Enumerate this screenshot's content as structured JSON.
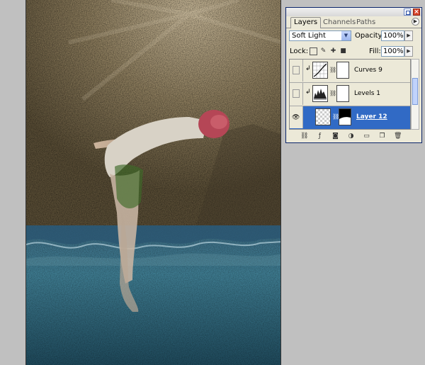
{
  "panel": {
    "tabs": [
      {
        "label": "Layers",
        "active": true
      },
      {
        "label": "Channels",
        "active": false
      },
      {
        "label": "Paths",
        "active": false
      }
    ],
    "blend_mode": "Soft Light",
    "opacity_label": "Opacity:",
    "opacity_value": "100%",
    "lock_label": "Lock:",
    "fill_label": "Fill:",
    "fill_value": "100%",
    "layers": [
      {
        "name": "Curves 9",
        "visible": false,
        "selected": false,
        "clipped": true,
        "type": "curves"
      },
      {
        "name": "Levels 1",
        "visible": false,
        "selected": false,
        "clipped": true,
        "type": "levels"
      },
      {
        "name": "Layer 12",
        "visible": true,
        "selected": true,
        "clipped": false,
        "type": "pixel"
      }
    ],
    "icons": {
      "close": "close-icon",
      "minimize": "minimize-icon",
      "panel_menu": "panel-menu-icon",
      "bottom": [
        "link-layers-icon",
        "layer-style-icon",
        "add-mask-icon",
        "adjustment-layer-icon",
        "new-group-icon",
        "new-layer-icon",
        "delete-layer-icon"
      ]
    }
  },
  "colors": {
    "selection": "#316ac5",
    "panel_bg": "#ece9d8",
    "workspace": "#c0c0c0"
  }
}
